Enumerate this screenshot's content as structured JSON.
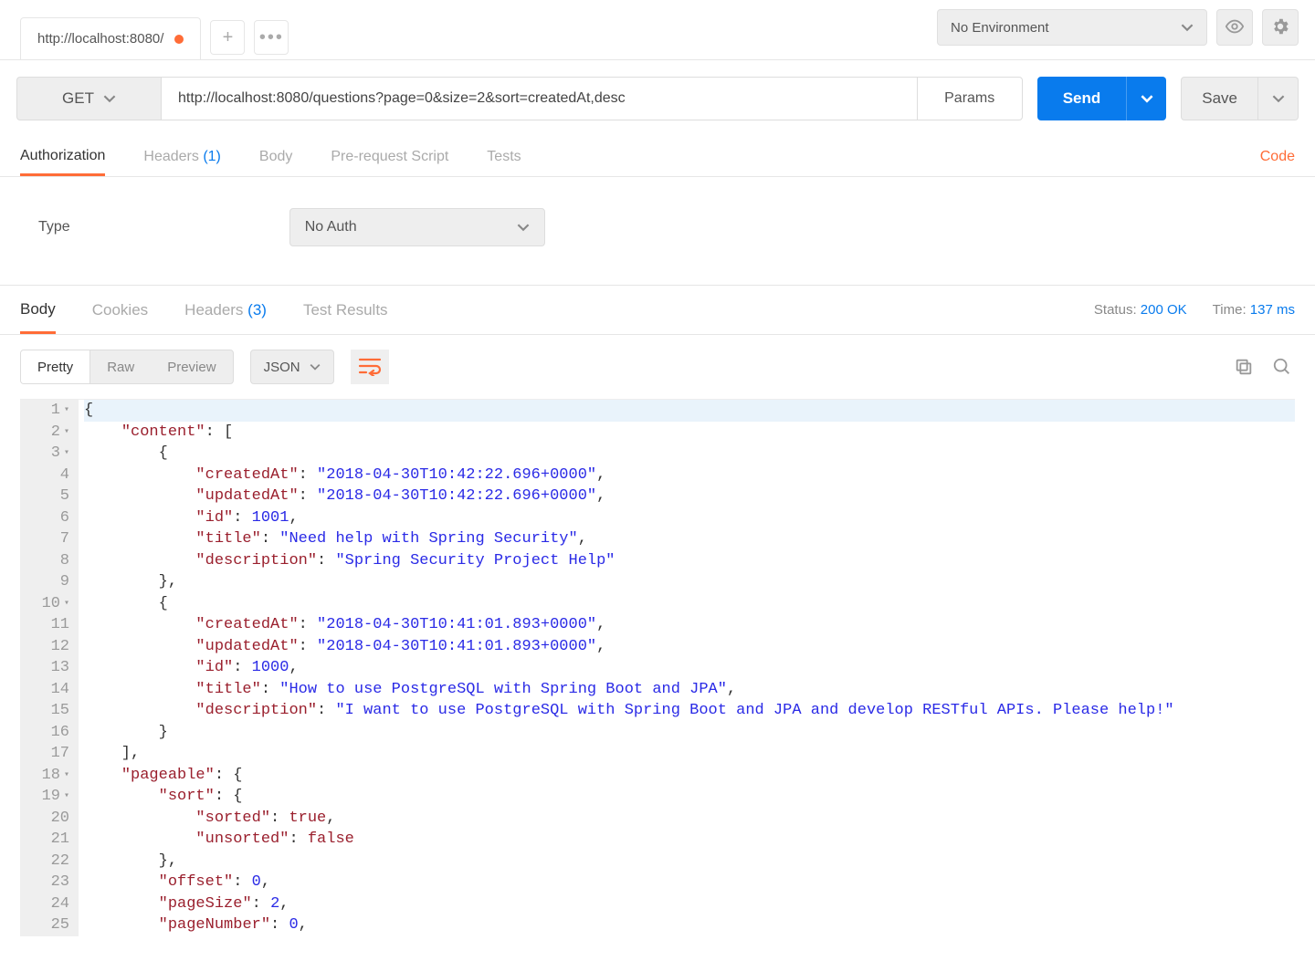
{
  "tab": {
    "title": "http://localhost:8080/"
  },
  "env": {
    "selected": "No Environment"
  },
  "request": {
    "method": "GET",
    "url": "http://localhost:8080/questions?page=0&size=2&sort=createdAt,desc",
    "params_label": "Params",
    "send_label": "Send",
    "save_label": "Save"
  },
  "reqTabs": {
    "authorization": "Authorization",
    "headers": "Headers",
    "headers_count": "(1)",
    "body": "Body",
    "prereq": "Pre-request Script",
    "tests": "Tests",
    "code": "Code"
  },
  "auth": {
    "type_label": "Type",
    "selected": "No Auth"
  },
  "respTabs": {
    "body": "Body",
    "cookies": "Cookies",
    "headers": "Headers",
    "headers_count": "(3)",
    "test_results": "Test Results"
  },
  "status": {
    "status_label": "Status:",
    "status_value": "200 OK",
    "time_label": "Time:",
    "time_value": "137 ms"
  },
  "bodyToolbar": {
    "pretty": "Pretty",
    "raw": "Raw",
    "preview": "Preview",
    "format": "JSON"
  },
  "responseBody": {
    "content": [
      {
        "createdAt": "2018-04-30T10:42:22.696+0000",
        "updatedAt": "2018-04-30T10:42:22.696+0000",
        "id": 1001,
        "title": "Need help with Spring Security",
        "description": "Spring Security Project Help"
      },
      {
        "createdAt": "2018-04-30T10:41:01.893+0000",
        "updatedAt": "2018-04-30T10:41:01.893+0000",
        "id": 1000,
        "title": "How to use PostgreSQL with Spring Boot and JPA",
        "description": "I want to use PostgreSQL with Spring Boot and JPA and develop RESTful APIs. Please help!"
      }
    ],
    "pageable": {
      "sort": {
        "sorted": true,
        "unsorted": false
      },
      "offset": 0,
      "pageSize": 2,
      "pageNumber": 0
    }
  }
}
